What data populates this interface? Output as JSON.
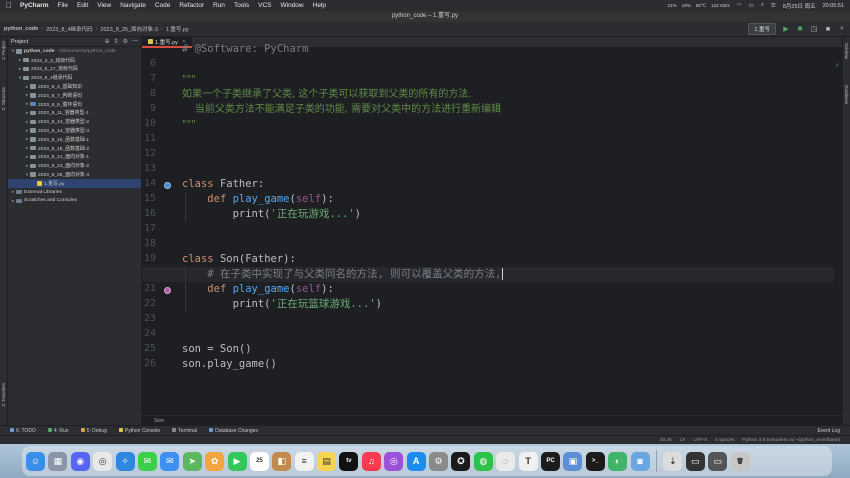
{
  "menubar": {
    "apple": "",
    "app_name": "PyCharm",
    "items": [
      "File",
      "Edit",
      "View",
      "Navigate",
      "Code",
      "Refactor",
      "Run",
      "Tools",
      "VCS",
      "Window",
      "Help"
    ],
    "stats": [
      "21%",
      "19%",
      "60℃",
      "122 KB/s"
    ],
    "date": "8月25日 周五",
    "time": "20:05:51"
  },
  "window": {
    "title": "python_code – 1.重写.py"
  },
  "toolbar": {
    "breadcrumbs": [
      "python_code",
      "2023_8_4继承代码",
      "2023_8_25_面向对象-3",
      "1.重写.py"
    ],
    "run_config": "1.重写"
  },
  "left_strip": {
    "labels": [
      "1: Project",
      "2: Structure",
      "2: Favorites"
    ]
  },
  "right_strip": {
    "labels": [
      "SciView",
      "Database"
    ]
  },
  "project": {
    "header": "Project",
    "tree": [
      {
        "label": "python_code",
        "hint": "~/Documents/python_code",
        "indent": 0,
        "open": true,
        "type": "folder"
      },
      {
        "label": "2023_3_3_班级代码",
        "indent": 1,
        "open": false,
        "type": "folder"
      },
      {
        "label": "2023_5_17_班级代码",
        "indent": 1,
        "open": false,
        "type": "folder"
      },
      {
        "label": "2023_8_4继承代码",
        "indent": 1,
        "open": true,
        "type": "folder"
      },
      {
        "label": "2023_8_4_基础知识",
        "indent": 2,
        "open": false,
        "type": "folder"
      },
      {
        "label": "2023_8_7_判断语句",
        "indent": 2,
        "open": false,
        "type": "folder"
      },
      {
        "label": "2023_8_9_循环语句",
        "indent": 2,
        "open": false,
        "type": "folder-blue"
      },
      {
        "label": "2023_8_11_容器类型-1",
        "indent": 2,
        "open": false,
        "type": "folder"
      },
      {
        "label": "2023_8_14_容器类型-2",
        "indent": 2,
        "open": false,
        "type": "folder"
      },
      {
        "label": "2023_8_14_容器类型-3",
        "indent": 2,
        "open": false,
        "type": "folder"
      },
      {
        "label": "2023_8_16_函数基础-1",
        "indent": 2,
        "open": false,
        "type": "folder"
      },
      {
        "label": "2023_8_18_函数基础-2",
        "indent": 2,
        "open": false,
        "type": "folder"
      },
      {
        "label": "2023_8_21_面向对象-1",
        "indent": 2,
        "open": false,
        "type": "folder"
      },
      {
        "label": "2023_8_23_面向对象-2",
        "indent": 2,
        "open": false,
        "type": "folder"
      },
      {
        "label": "2023_8_25_面向对象-3",
        "indent": 2,
        "open": true,
        "type": "folder"
      },
      {
        "label": "1.重写.py",
        "indent": 3,
        "open": null,
        "type": "py",
        "selected": true
      },
      {
        "label": "External Libraries",
        "indent": 0,
        "open": false,
        "type": "lib"
      },
      {
        "label": "Scratches and Consoles",
        "indent": 0,
        "open": false,
        "type": "lib"
      }
    ]
  },
  "editor": {
    "tab_label": "1.重写.py",
    "current_line": 20,
    "bottom_crumb": "Son",
    "lines": [
      {
        "n": "",
        "segs": [
          {
            "c": "cmt",
            "t": "# @Software: PyCharm"
          }
        ]
      },
      {
        "n": "6",
        "segs": []
      },
      {
        "n": "7",
        "segs": [
          {
            "c": "doc",
            "t": "\"\"\""
          }
        ]
      },
      {
        "n": "8",
        "segs": [
          {
            "c": "doc",
            "t": "如果一个子类继承了父类, 这个子类可以获取到父类的所有的方法."
          }
        ]
      },
      {
        "n": "9",
        "segs": [
          {
            "c": "doc",
            "t": "    当前父类方法不能满足子类的功能, 需要对父类中的方法进行重新编辑"
          }
        ]
      },
      {
        "n": "10",
        "segs": [
          {
            "c": "doc",
            "t": "\"\"\""
          }
        ]
      },
      {
        "n": "11",
        "segs": []
      },
      {
        "n": "12",
        "segs": []
      },
      {
        "n": "13",
        "segs": []
      },
      {
        "n": "14",
        "segs": [
          {
            "c": "kw",
            "t": "class "
          },
          {
            "c": "",
            "t": "Father:"
          }
        ],
        "marker": "down"
      },
      {
        "n": "15",
        "segs": [
          {
            "c": "",
            "t": "    "
          },
          {
            "c": "kw",
            "t": "def "
          },
          {
            "c": "fn",
            "t": "play_game"
          },
          {
            "c": "",
            "t": "("
          },
          {
            "c": "slf",
            "t": "self"
          },
          {
            "c": "",
            "t": "):"
          }
        ]
      },
      {
        "n": "16",
        "segs": [
          {
            "c": "",
            "t": "        print("
          },
          {
            "c": "str",
            "t": "'正在玩游戏...'"
          },
          {
            "c": "",
            "t": ")"
          }
        ]
      },
      {
        "n": "17",
        "segs": []
      },
      {
        "n": "18",
        "segs": []
      },
      {
        "n": "19",
        "segs": [
          {
            "c": "kw",
            "t": "class "
          },
          {
            "c": "",
            "t": "Son(Father):"
          }
        ]
      },
      {
        "n": "20",
        "segs": [
          {
            "c": "",
            "t": "    "
          },
          {
            "c": "cmt",
            "t": "# 在子类中实现了与父类同名的方法, 则可以覆盖父类的方法,"
          }
        ]
      },
      {
        "n": "21",
        "segs": [
          {
            "c": "",
            "t": "    "
          },
          {
            "c": "kw",
            "t": "def "
          },
          {
            "c": "fn",
            "t": "play_game"
          },
          {
            "c": "",
            "t": "("
          },
          {
            "c": "slf",
            "t": "self"
          },
          {
            "c": "",
            "t": "):"
          }
        ],
        "marker": "up"
      },
      {
        "n": "22",
        "segs": [
          {
            "c": "",
            "t": "        print("
          },
          {
            "c": "str",
            "t": "'正在玩篮球游戏...'"
          },
          {
            "c": "",
            "t": ")"
          }
        ]
      },
      {
        "n": "23",
        "segs": []
      },
      {
        "n": "24",
        "segs": []
      },
      {
        "n": "25",
        "segs": [
          {
            "c": "",
            "t": "son = Son()"
          }
        ]
      },
      {
        "n": "26",
        "segs": [
          {
            "c": "",
            "t": "son.play_game()"
          }
        ]
      }
    ]
  },
  "bottom_tools": {
    "items": [
      "6: TODO",
      "4: Run",
      "5: Debug",
      "Python Console",
      "Terminal",
      "Database Changes"
    ],
    "event_log": "Event Log"
  },
  "statusbar": {
    "items": [
      "20:35",
      "LF",
      "UTF-8",
      "4 spaces",
      "Python 3.9 (virtualenv at ~/python_envs/base)"
    ]
  },
  "dock": {
    "apps": [
      {
        "name": "finder-icon",
        "color": "#3b8ee8",
        "glyph": "☺"
      },
      {
        "name": "launchpad-icon",
        "color": "#8b95a8",
        "glyph": "▦"
      },
      {
        "name": "discord-icon",
        "color": "#5865f2",
        "glyph": "◉"
      },
      {
        "name": "chrome-icon",
        "color": "#e8e8e8",
        "glyph": "◎"
      },
      {
        "name": "safari-icon",
        "color": "#2f88e0",
        "glyph": "✧"
      },
      {
        "name": "messages-icon",
        "color": "#3ccf4e",
        "glyph": "✉"
      },
      {
        "name": "mail-icon",
        "color": "#3e90f0",
        "glyph": "✉"
      },
      {
        "name": "maps-icon",
        "color": "#5bb85f",
        "glyph": "➤"
      },
      {
        "name": "photos-icon",
        "color": "#f3a640",
        "glyph": "✿"
      },
      {
        "name": "facetime-icon",
        "color": "#34c759",
        "glyph": "▶"
      },
      {
        "name": "calendar-icon",
        "color": "#ffffff",
        "glyph": "25"
      },
      {
        "name": "contacts-icon",
        "color": "#c28a4d",
        "glyph": "◧"
      },
      {
        "name": "reminders-icon",
        "color": "#f2f2f2",
        "glyph": "≡"
      },
      {
        "name": "notes-icon",
        "color": "#f7d352",
        "glyph": "▤"
      },
      {
        "name": "appletv-icon",
        "color": "#111111",
        "glyph": "tv"
      },
      {
        "name": "music-icon",
        "color": "#fa3a4e",
        "glyph": "♫"
      },
      {
        "name": "podcasts-icon",
        "color": "#9b52d9",
        "glyph": "◎"
      },
      {
        "name": "appstore-icon",
        "color": "#1d8cf0",
        "glyph": "A"
      },
      {
        "name": "system-settings-icon",
        "color": "#8a8a8a",
        "glyph": "⚙"
      },
      {
        "name": "qq-icon",
        "color": "#1a1a1a",
        "glyph": "✪"
      },
      {
        "name": "wechat-icon",
        "color": "#2fc24a",
        "glyph": "◍"
      },
      {
        "name": "qq-chat-icon",
        "color": "#eaeaea",
        "glyph": "◌"
      },
      {
        "name": "typora-icon",
        "color": "#f0f0f0",
        "glyph": "T"
      },
      {
        "name": "pycharm-icon",
        "color": "#1c1c1c",
        "glyph": "PC"
      },
      {
        "name": "preview-icon",
        "color": "#5d8fd6",
        "glyph": "▣"
      },
      {
        "name": "terminal-icon",
        "color": "#1b1b1b",
        "glyph": ">_"
      },
      {
        "name": "vpn-icon",
        "color": "#3fb56b",
        "glyph": "◐"
      },
      {
        "name": "camera-icon",
        "color": "#6aa6e0",
        "glyph": "◙"
      },
      {
        "name": "downloads-icon",
        "color": "#dcdcdc",
        "glyph": "⇣"
      },
      {
        "name": "screenshot-stack-icon",
        "color": "#333333",
        "glyph": "▭"
      },
      {
        "name": "screen-recorder-icon",
        "color": "#555555",
        "glyph": "▭"
      },
      {
        "name": "trash-icon",
        "color": "#c7c7c7",
        "glyph": "🗑"
      }
    ]
  }
}
